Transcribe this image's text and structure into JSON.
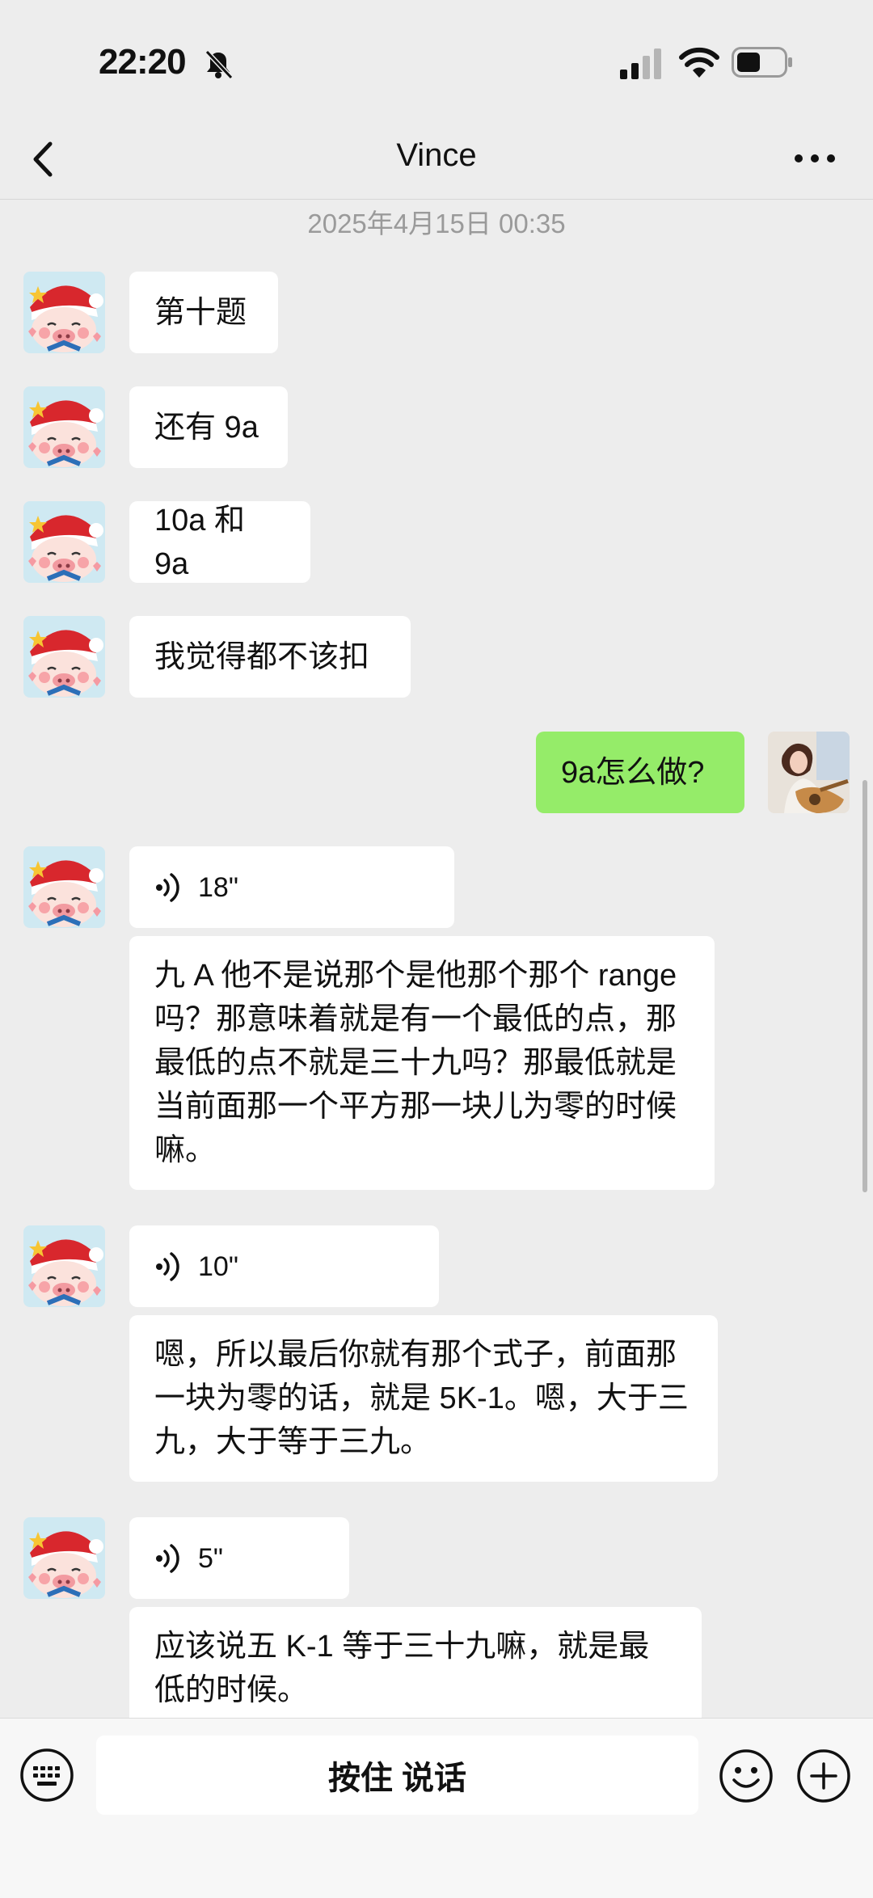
{
  "status_bar": {
    "time": "22:20"
  },
  "nav": {
    "title": "Vince"
  },
  "chat": {
    "timestamp": "2025年4月15日 00:35",
    "messages": [
      {
        "text": "第十题"
      },
      {
        "text": "还有 9a"
      },
      {
        "text": "10a 和 9a"
      },
      {
        "text": "我觉得都不该扣"
      },
      {
        "text": "9a怎么做?"
      },
      {
        "voice_duration": "18\"",
        "transcript": "九 A 他不是说那个是他那个那个 range 吗？那意味着就是有一个最低的点，那最低的点不就是三十九吗？那最低就是当前面那一个平方那一块儿为零的时候嘛。"
      },
      {
        "voice_duration": "10\"",
        "transcript": "嗯，所以最后你就有那个式子，前面那一块为零的话，就是 5K-1。嗯，大于三九，大于等于三九。"
      },
      {
        "voice_duration": "5\"",
        "transcript": "应该说五 K-1 等于三十九嘛，就是最低的时候。"
      }
    ]
  },
  "input_bar": {
    "hold_to_talk": "按住 说话"
  },
  "colors": {
    "background": "#ededed",
    "bubble_in": "#ffffff",
    "bubble_out": "#95ec69"
  },
  "icons": [
    "mute-icon",
    "signal-icon",
    "wifi-icon",
    "battery-icon",
    "back-icon",
    "more-icon",
    "voice-icon",
    "keyboard-icon",
    "emoji-icon",
    "plus-icon"
  ]
}
